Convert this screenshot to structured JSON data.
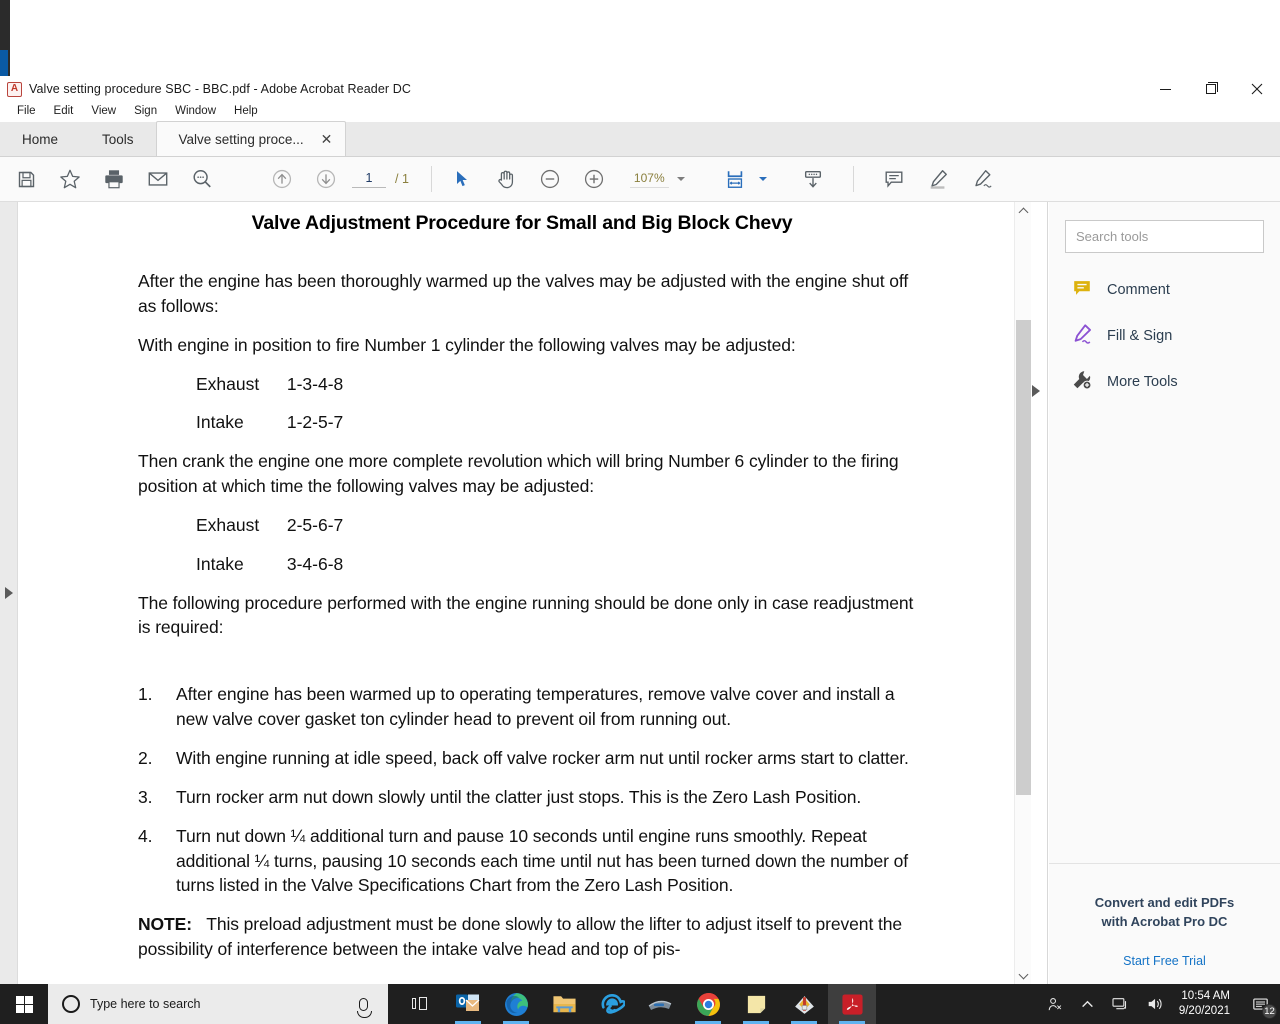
{
  "window": {
    "title": "Valve setting procedure SBC - BBC.pdf - Adobe Acrobat Reader DC",
    "app_badge": "A",
    "minimize": "—",
    "maximize": "□",
    "close": "✕"
  },
  "menubar": {
    "items": [
      "File",
      "Edit",
      "View",
      "Sign",
      "Window",
      "Help"
    ]
  },
  "tabs": [
    {
      "label": "Home",
      "active": false,
      "closable": false
    },
    {
      "label": "Tools",
      "active": false,
      "closable": false
    },
    {
      "label": "Valve setting proce...",
      "active": true,
      "closable": true,
      "close_glyph": "✕"
    }
  ],
  "toolbar": {
    "save_label": "save-icon",
    "star_label": "add-to-favorites-icon",
    "print_label": "print-icon",
    "email_label": "email-icon",
    "find_label": "find-icon",
    "prev_page_label": "previous-page-icon",
    "next_page_label": "next-page-icon",
    "page_current": "1",
    "page_separator": "/",
    "page_total": "1",
    "select_label": "select-tool-icon",
    "hand_label": "hand-tool-icon",
    "zoom_out_label": "zoom-out-icon",
    "zoom_in_label": "zoom-in-icon",
    "zoom_value": "107%",
    "fit_label": "fit-page-icon",
    "scroll_mode_label": "page-display-icon",
    "comment_label": "comment-icon",
    "highlight_label": "highlight-icon",
    "sign_label": "fill-and-sign-icon"
  },
  "document": {
    "title": "Valve Adjustment Procedure for Small and Big Block Chevy",
    "paragraphs": [
      "After the engine has been thoroughly warmed up the valves may be adjusted with the engine shut off as follows:",
      "With engine in position to fire Number 1 cylinder the following valves may be adjusted:"
    ],
    "valve_set_1": [
      {
        "label": "Exhaust",
        "value": "1-3-4-8"
      },
      {
        "label": "Intake",
        "value": "1-2-5-7"
      }
    ],
    "paragraph_3": "Then crank the engine one more complete revolution which will bring Number 6 cylinder to the firing position at which time the following valves may be adjusted:",
    "valve_set_2": [
      {
        "label": "Exhaust",
        "value": "2-5-6-7"
      },
      {
        "label": "Intake",
        "value": "3-4-6-8"
      }
    ],
    "paragraph_4": "The following procedure performed with the engine running should be done only in case readjustment is required:",
    "steps": [
      {
        "num": "1.",
        "text": "After engine has been warmed up to operating temperatures, remove valve cover and install a new valve cover gasket ton cylinder head to prevent oil from running out."
      },
      {
        "num": "2.",
        "text": "With engine running at idle speed, back off valve rocker arm nut until rocker arms start to clatter."
      },
      {
        "num": "3.",
        "text": "Turn rocker arm nut down slowly until the clatter just stops.  This is the Zero Lash Position."
      },
      {
        "num": "4.",
        "text": "Turn nut down ¼ additional turn and pause 10 seconds until engine runs smoothly.  Repeat additional ¼ turns, pausing 10 seconds each time until nut has been turned down the number of turns listed in the Valve Specifications Chart from the Zero Lash Position."
      }
    ],
    "note_label": "NOTE:",
    "note_text": "This preload adjustment must be done slowly to allow the lifter to adjust itself",
    "note_clipped": "to prevent the possibility of interference between the intake valve head and top of pis-"
  },
  "tools_pane": {
    "search_placeholder": "Search tools",
    "items": [
      {
        "label": "Comment",
        "icon": "comment-icon",
        "color": "#ddb20e"
      },
      {
        "label": "Fill & Sign",
        "icon": "fill-and-sign-icon",
        "color": "#8c52d3"
      },
      {
        "label": "More Tools",
        "icon": "more-tools-icon",
        "color": "#4a4a4a"
      }
    ],
    "promo_line1": "Convert and edit PDFs",
    "promo_line2": "with Acrobat Pro DC",
    "promo_link": "Start Free Trial"
  },
  "taskbar": {
    "search_placeholder": "Type here to search",
    "apps": [
      {
        "name": "task-view",
        "letter": ""
      },
      {
        "name": "outlook",
        "letter": "O",
        "color": "#0a64a8",
        "running": true
      },
      {
        "name": "microsoft-edge",
        "letter": "e",
        "color": "#1f7fd4",
        "running": true
      },
      {
        "name": "file-explorer",
        "letter": "",
        "color": "#f5c06b",
        "running": false
      },
      {
        "name": "internet-explorer",
        "letter": "e",
        "color": "#1f7fd4",
        "running": false
      },
      {
        "name": "scanner",
        "letter": "",
        "color": "#5b6b7a",
        "running": false
      },
      {
        "name": "google-chrome",
        "letter": "",
        "color": "#e8413a",
        "running": true
      },
      {
        "name": "sticky-notes",
        "letter": "",
        "color": "#f2e6a8",
        "running": true
      },
      {
        "name": "winzip",
        "letter": "",
        "color": "#c9a227",
        "running": true
      },
      {
        "name": "adobe-acrobat-reader",
        "letter": "A",
        "color": "#c81f28",
        "running": true,
        "active": true
      }
    ],
    "tray": {
      "people": "people-icon",
      "chevron": "show-hidden-icons",
      "network": "network-icon",
      "volume": "volume-icon",
      "time": "10:54 AM",
      "date": "9/20/2021",
      "notification_count": "12"
    }
  },
  "colors": {
    "accent_blue": "#2a6ebb",
    "tab_active_bg": "#fafafa",
    "toolbar_bg": "#fafafa",
    "tools_pane_bg": "#fafafa",
    "taskbar_bg": "#1f1f1f",
    "link_blue": "#1473c6"
  }
}
